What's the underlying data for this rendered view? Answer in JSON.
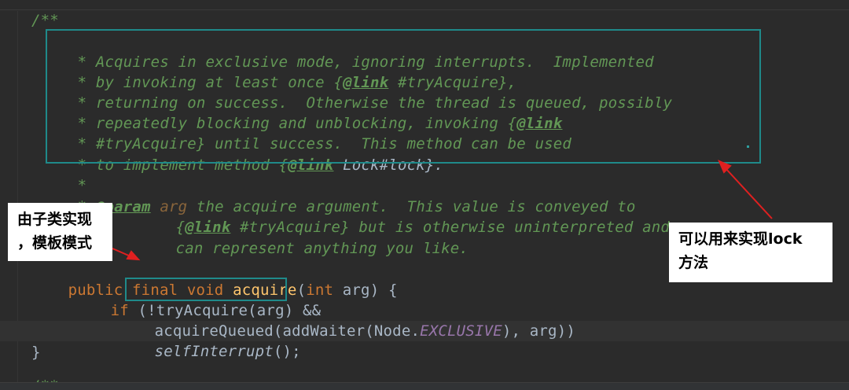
{
  "code": {
    "doc_open": "/**",
    "doc_lines": [
      "Acquires in exclusive mode, ignoring interrupts.  Implemented",
      "by invoking at least once {",
      "returning on success.  Otherwise the thread is queued, possibly",
      "repeatedly blocking and unblocking, invoking {",
      "#tryAcquire} until success.  This method can be used",
      "to implement method {"
    ],
    "link_tag": "@link",
    "link_tryacquire": " #tryAcquire},",
    "link_lock": " Lock#lock}.",
    "param_tag": "@param",
    "param_name": "arg",
    "param_desc1": " the acquire argument.  This value is conveyed to",
    "param_desc2a": "{",
    "param_desc2b": " #tryAcquire} but is otherwise uninterpreted and",
    "param_desc3": "can represent anything you like.",
    "sig_public": "public",
    "sig_final": "final",
    "sig_void": "void",
    "sig_name": "acquire",
    "sig_paren_open": "(",
    "sig_int": "int",
    "sig_params": " arg) {",
    "if_kw": "if",
    "if_open": " (!",
    "try_call": "tryAcquire(arg)",
    "if_and": " &&",
    "acq_queued": "acquireQueued(addWaiter(Node.",
    "exclusive": "EXCLUSIVE",
    "acq_tail": "), arg))",
    "self_interrupt": "selfInterrupt",
    "self_tail": "();",
    "close_brace": "}",
    "next_doc": "/**"
  },
  "annotations": {
    "left_callout_line1": "由子类实现",
    "left_callout_line2": "，模板模式",
    "right_callout_line1": "可以用来实现lock",
    "right_callout_line2": "方法"
  },
  "colors": {
    "background": "#2b2b2b",
    "doc_comment": "#629755",
    "keyword": "#cc7832",
    "method": "#ffc66d",
    "text": "#a9b7c6",
    "constant": "#9876aa",
    "highlight_box": "#1f8a8a",
    "arrow": "#e02020"
  }
}
